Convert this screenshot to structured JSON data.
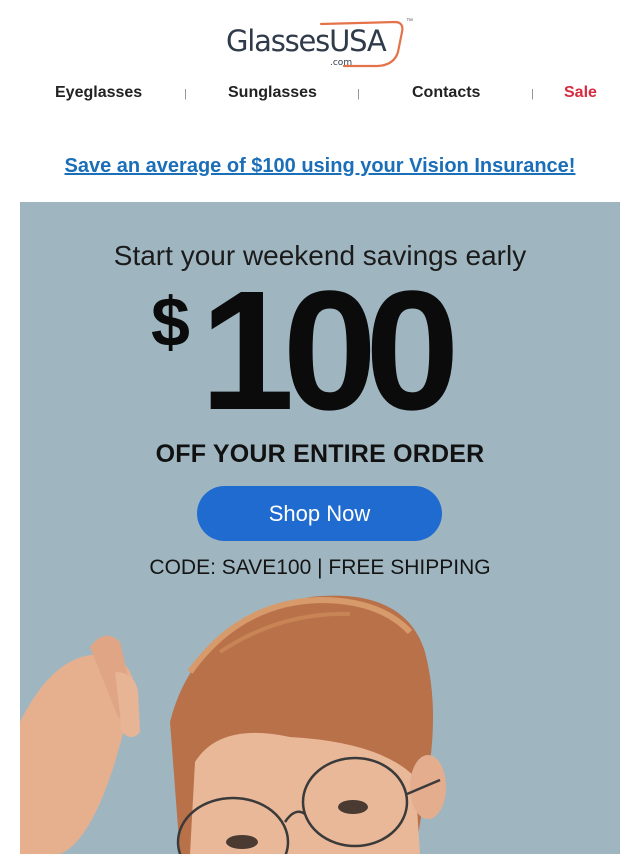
{
  "brand": {
    "logo_text": "GlassesUSA",
    "logo_suffix": ".com",
    "trademark": "™"
  },
  "nav": {
    "items": [
      {
        "label": "Eyeglasses"
      },
      {
        "label": "Sunglasses"
      },
      {
        "label": "Contacts"
      },
      {
        "label": "Sale"
      }
    ],
    "separator": "|"
  },
  "promo_link": "Save an average of $100 using your Vision Insurance!",
  "hero": {
    "tagline": "Start your weekend savings early",
    "currency": "$",
    "amount": "100",
    "offer": "OFF YOUR ENTIRE ORDER",
    "cta_label": "Shop Now",
    "code_line": "CODE: SAVE100 | FREE SHIPPING"
  },
  "colors": {
    "sale": "#d72b3f",
    "link": "#1a6fb8",
    "cta": "#1f6bd0",
    "hero_bg": "#9fb6c1",
    "logo_accent": "#e5734a"
  }
}
